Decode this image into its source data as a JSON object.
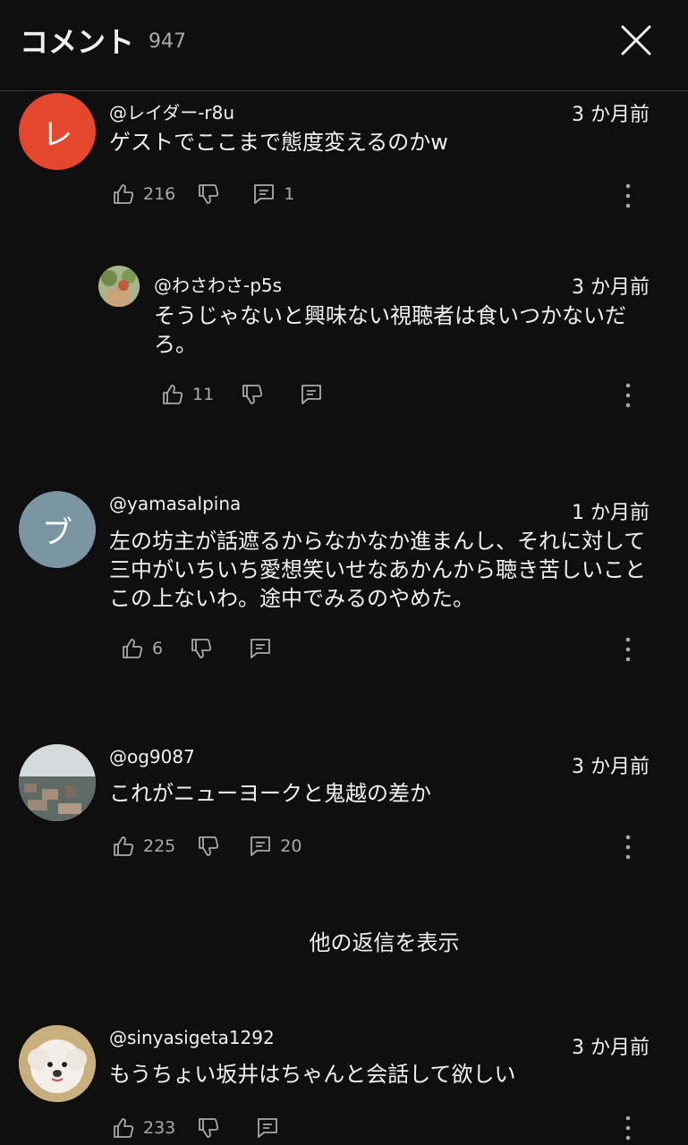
{
  "header": {
    "title": "コメント",
    "count": "947"
  },
  "comments": [
    {
      "avatar_letter": "レ",
      "avatar_color": "#e5472e",
      "author": "@レイダー-r8u",
      "time": "3 か月前",
      "text": "ゲストでここまで態度変えるのかw",
      "likes": "216",
      "replies": "1"
    },
    {
      "author": "@わさわさ-p5s",
      "time": "3 か月前",
      "text": "そうじゃないと興味ない視聴者は食いつかないだろ。",
      "likes": "11",
      "replies": ""
    },
    {
      "avatar_letter": "ブ",
      "avatar_color": "#7c95a3",
      "author": "@yamasalpina",
      "time": "1 か月前",
      "text": "左の坊主が話遮るからなかなか進まんし、それに対して三中がいちいち愛想笑いせなあかんから聴き苦しいことこの上ないわ。途中でみるのやめた。",
      "likes": "6",
      "replies": ""
    },
    {
      "author": "@og9087",
      "time": "3 か月前",
      "text": "これがニューヨークと鬼越の差か",
      "likes": "225",
      "replies": "20"
    },
    {
      "author": "@sinyasigeta1292",
      "time": "3 か月前",
      "text": "もうちょい坂井はちゃんと会話して欲しい",
      "likes": "233",
      "replies": ""
    }
  ],
  "show_more_replies": "他の返信を表示",
  "icons": {
    "close": "close-icon",
    "like": "thumbs-up-icon",
    "dislike": "thumbs-down-icon",
    "reply": "reply-icon",
    "more": "more-vert-icon"
  }
}
